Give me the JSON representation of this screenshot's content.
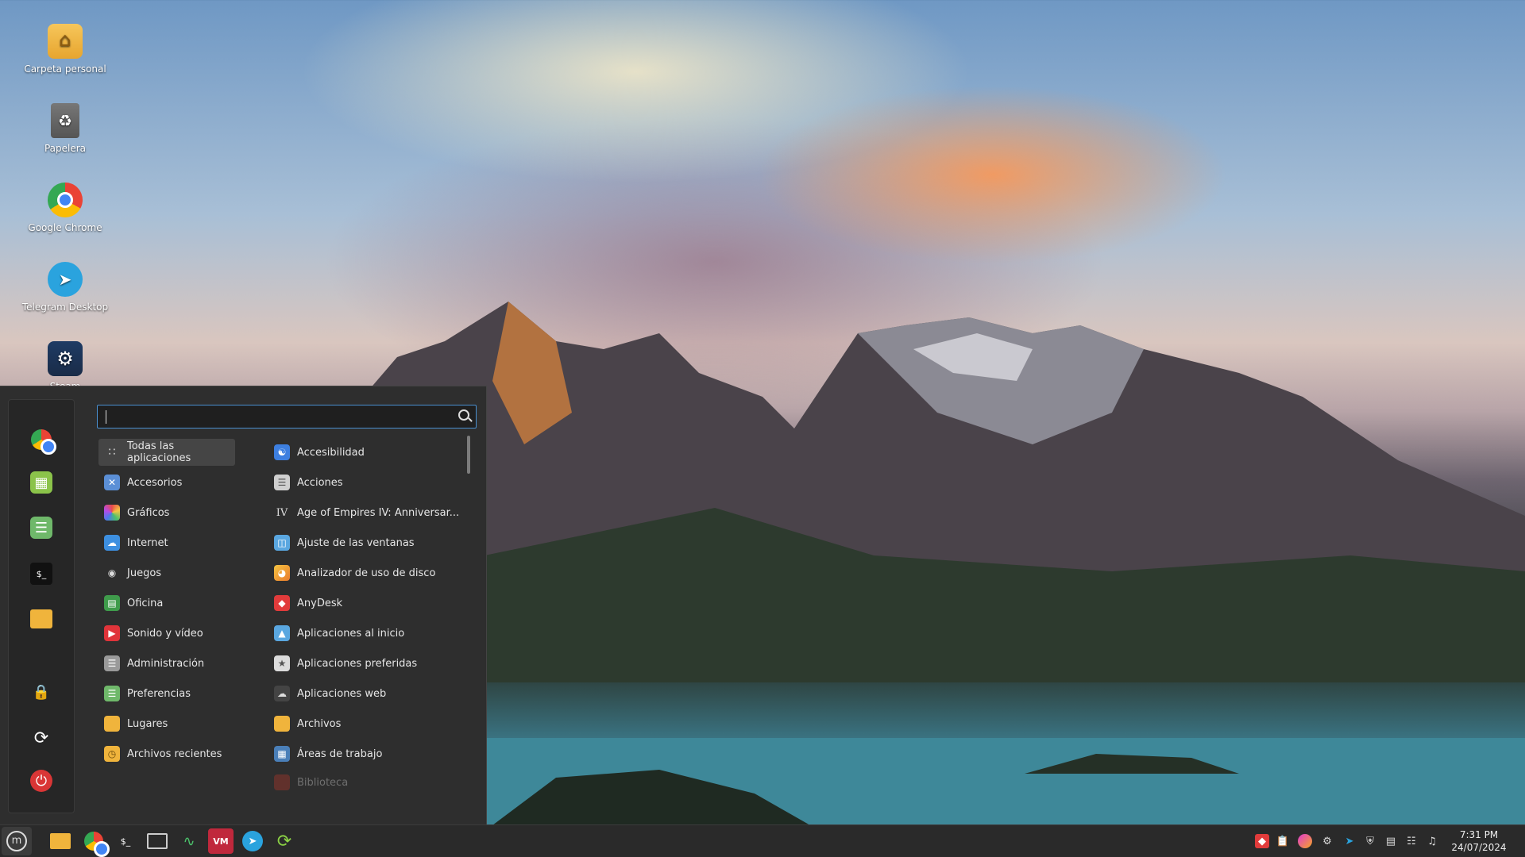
{
  "desktop": {
    "icons": [
      {
        "label": "Carpeta personal",
        "icon": "home-folder-icon"
      },
      {
        "label": "Papelera",
        "icon": "trash-icon"
      },
      {
        "label": "Google Chrome",
        "icon": "chrome-icon"
      },
      {
        "label": "Telegram Desktop",
        "icon": "telegram-icon"
      },
      {
        "label": "Steam",
        "icon": "steam-icon"
      }
    ]
  },
  "menu": {
    "search": {
      "value": "",
      "placeholder": ""
    },
    "favorites": [
      "chrome-icon",
      "calculator-icon",
      "settings-icon",
      "terminal-icon",
      "files-icon"
    ],
    "session": [
      "lock-icon",
      "logout-icon",
      "power-icon"
    ],
    "categories": [
      {
        "label": "Todas las aplicaciones",
        "icon": "grid-icon",
        "selected": true
      },
      {
        "label": "Accesorios",
        "icon": "accessories-icon"
      },
      {
        "label": "Gráficos",
        "icon": "graphics-icon"
      },
      {
        "label": "Internet",
        "icon": "internet-icon"
      },
      {
        "label": "Juegos",
        "icon": "games-icon"
      },
      {
        "label": "Oficina",
        "icon": "office-icon"
      },
      {
        "label": "Sonido y vídeo",
        "icon": "media-icon"
      },
      {
        "label": "Administración",
        "icon": "admin-icon"
      },
      {
        "label": "Preferencias",
        "icon": "preferences-icon"
      },
      {
        "label": "Lugares",
        "icon": "places-icon"
      },
      {
        "label": "Archivos recientes",
        "icon": "recent-icon"
      }
    ],
    "apps": [
      {
        "label": "Accesibilidad",
        "icon": "accessibility-icon"
      },
      {
        "label": "Acciones",
        "icon": "actions-icon"
      },
      {
        "label": "Age of Empires IV: Anniversar...",
        "icon": "aoe-icon"
      },
      {
        "label": "Ajuste de las ventanas",
        "icon": "window-tiling-icon"
      },
      {
        "label": "Analizador de uso de disco",
        "icon": "disk-usage-icon"
      },
      {
        "label": "AnyDesk",
        "icon": "anydesk-icon"
      },
      {
        "label": "Aplicaciones al inicio",
        "icon": "startup-apps-icon"
      },
      {
        "label": "Aplicaciones preferidas",
        "icon": "preferred-apps-icon"
      },
      {
        "label": "Aplicaciones web",
        "icon": "web-apps-icon"
      },
      {
        "label": "Archivos",
        "icon": "files-icon"
      },
      {
        "label": "Áreas de trabajo",
        "icon": "workspaces-icon"
      },
      {
        "label": "Biblioteca",
        "icon": "library-icon"
      }
    ]
  },
  "taskbar": {
    "launchers": [
      "files-icon",
      "chrome-icon",
      "terminal-icon",
      "workspace-switcher-icon",
      "system-monitor-icon",
      "vm-icon",
      "telegram-icon",
      "update-manager-icon"
    ],
    "tray": [
      "anydesk-tray-icon",
      "clipboard-icon",
      "color-icon",
      "steam-tray-icon",
      "telegram-tray-icon",
      "shield-icon",
      "notes-icon",
      "network-icon",
      "volume-icon"
    ],
    "clock": {
      "time": "7:31 PM",
      "date": "24/07/2024"
    }
  },
  "colors": {
    "menu_bg": "#2e2e2e",
    "accent": "#4a8fd0",
    "taskbar_bg": "#2a2a2a"
  }
}
